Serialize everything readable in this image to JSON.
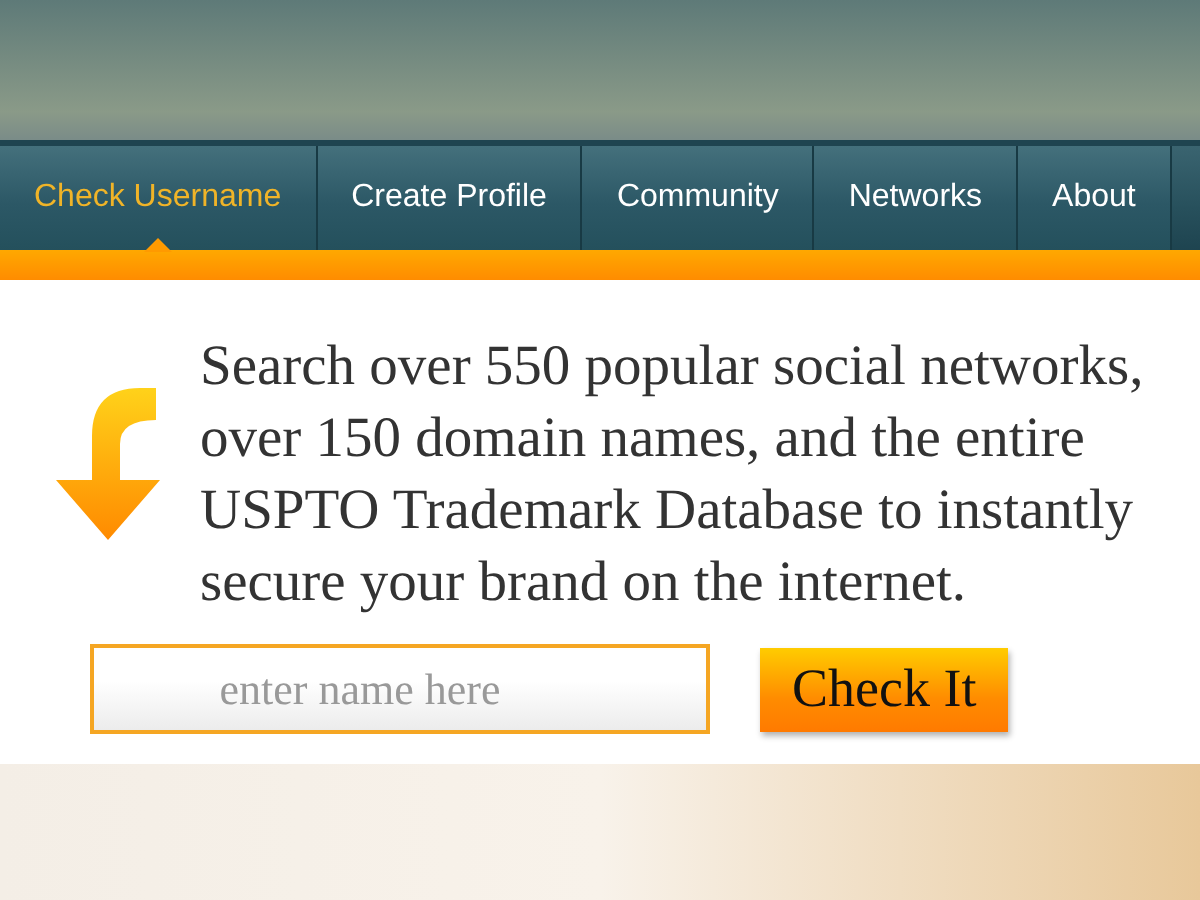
{
  "nav": {
    "tabs": [
      {
        "label": "Check Username",
        "selected": true
      },
      {
        "label": "Create Profile",
        "selected": false
      },
      {
        "label": "Community",
        "selected": false
      },
      {
        "label": "Networks",
        "selected": false
      },
      {
        "label": "About",
        "selected": false
      }
    ]
  },
  "intro": "Search over 550 popular social networks, over 150 domain names, and the entire USPTO Trademark Database to instantly secure your brand on the internet.",
  "search": {
    "placeholder": "enter name here",
    "button": "Check It"
  }
}
